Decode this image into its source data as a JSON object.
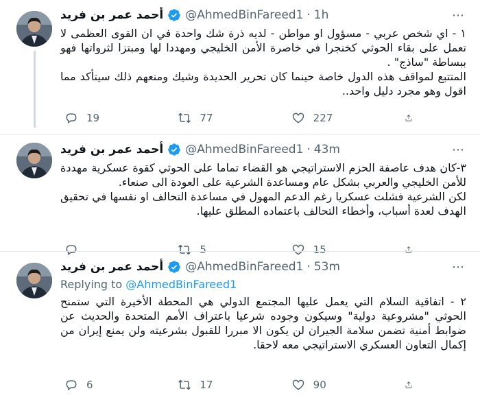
{
  "tweets": [
    {
      "author_name": "أحمد عمر بن فريد",
      "handle": "@AhmedBinFareed1",
      "separator": "·",
      "time": "1h",
      "replying_prefix": "",
      "replying_to": "",
      "paragraphs": [
        "١ - اي شخص عربي - مسؤول او مواطن - لديه ذرة شك واحدة في ان القوى العظمى لا تعمل على بقاء الحوثي كخنجرا في خاصرة الأمن الخليجي ومهددا لها ومبتزا لثرواتها فهو ببساطة \"ساذج\" .",
        "المتتبع لمواقف هذه الدول خاصة حينما كان تحرير الحديدة وشيك ومنعهم ذلك سيتأكد مما اقول وهو مجرد دليل واحد.."
      ],
      "replies": "19",
      "retweets": "77",
      "likes": "227"
    },
    {
      "author_name": "أحمد عمر بن فريد",
      "handle": "@AhmedBinFareed1",
      "separator": "·",
      "time": "43m",
      "replying_prefix": "",
      "replying_to": "",
      "paragraphs": [
        "٣-كان هدف عاصفة الحزم الاستراتيجي هو القضاء تماما على الحوثي كقوة عسكرية مهددة للأمن الخليجي والعربي بشكل عام ومساعدة الشرعية على العودة الى صنعاء.",
        "لكن الشرعية فشلت عسكريا رغم الدعم المهول في مساعدة التحالف او نفسها في تحقيق الهدف لعدة أسباب، وأخطاء التحالف باعتماده المطلق عليها."
      ],
      "replies": "",
      "retweets": "5",
      "likes": "15"
    },
    {
      "author_name": "أحمد عمر بن فريد",
      "handle": "@AhmedBinFareed1",
      "separator": "·",
      "time": "53m",
      "replying_prefix": "Replying to ",
      "replying_to": "@AhmedBinFareed1",
      "paragraphs": [
        "٢ - اتفاقية السلام التي يعمل عليها المجتمع الدولي هي المحطة الأخيرة التي ستمنح الحوثي \"مشروعية دولية\" وسيكون وجوده شرعيا باعتراف الأمم المتحدة والحديث عن ضوابط أمنية تضمن سلامة الجيران لن يكون الا مبررا للقبول بشرعيته ولن يمنع إيران من إكمال التعاون العسكري الاستراتيجي معه لاحقا."
      ],
      "replies": "6",
      "retweets": "17",
      "likes": "90"
    }
  ],
  "icons": {
    "verified": "verified-badge-icon",
    "more": "more-options-icon",
    "reply": "reply-icon",
    "retweet": "retweet-icon",
    "like": "like-icon",
    "share": "share-icon"
  },
  "colors": {
    "accent": "#1d9bf0",
    "secondary_text": "#536471",
    "divider": "#e1e8ed",
    "thread_line": "#cfd9de"
  }
}
